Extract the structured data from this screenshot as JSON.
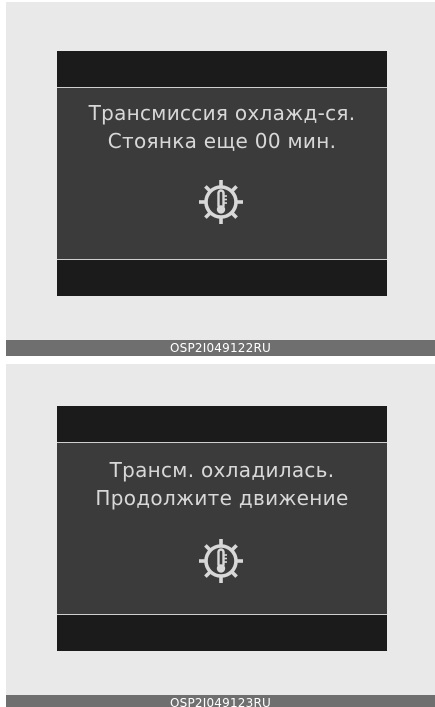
{
  "panels": [
    {
      "message_line1": "Трансмиссия охлажд-ся.",
      "message_line2": "Стоянка еще 00 мин.",
      "icon": "transmission-temperature-gear-icon",
      "caption": "OSP2I049122RU"
    },
    {
      "message_line1": "Трансм. охладилась.",
      "message_line2": "Продолжите движение",
      "icon": "transmission-temperature-gear-icon",
      "caption": "OSP2I049123RU"
    }
  ],
  "colors": {
    "screen_dark": "#181818",
    "screen_mid": "#3b3b3b",
    "text": "#d8d8d8",
    "caption_bar": "#6f6f6f"
  }
}
